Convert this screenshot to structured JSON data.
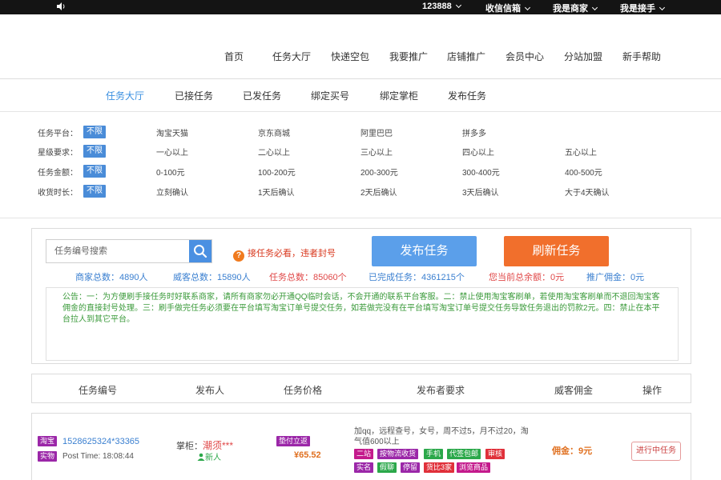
{
  "topbar": {
    "account": "123888",
    "items": [
      "收信信箱",
      "我是商家",
      "我是接手"
    ]
  },
  "main_nav": [
    "首页",
    "任务大厅",
    "快递空包",
    "我要推广",
    "店铺推广",
    "会员中心",
    "分站加盟",
    "新手帮助"
  ],
  "sub_nav": [
    "任务大厅",
    "已接任务",
    "已发任务",
    "绑定买号",
    "绑定掌柜",
    "发布任务"
  ],
  "filters": [
    {
      "label": "任务平台：",
      "badge": "不限",
      "options": [
        "淘宝天猫",
        "京东商城",
        "阿里巴巴",
        "拼多多"
      ]
    },
    {
      "label": "星级要求：",
      "badge": "不限",
      "options": [
        "一心以上",
        "二心以上",
        "三心以上",
        "四心以上",
        "五心以上"
      ]
    },
    {
      "label": "任务金额：",
      "badge": "不限",
      "options": [
        "0-100元",
        "100-200元",
        "200-300元",
        "300-400元",
        "400-500元"
      ]
    },
    {
      "label": "收货时长：",
      "badge": "不限",
      "options": [
        "立刻确认",
        "1天后确认",
        "2天后确认",
        "3天后确认",
        "大于4天确认"
      ]
    }
  ],
  "search": {
    "placeholder": "任务编号搜索",
    "warning": "接任务必看，违者封号",
    "publish_label": "发布任务",
    "refresh_label": "刷新任务"
  },
  "stats": [
    {
      "text": "商家总数：4890人",
      "color": "#3a7fd0"
    },
    {
      "text": "威客总数：15890人",
      "color": "#3a7fd0"
    },
    {
      "text": "任务总数：85060个",
      "color": "#e04848"
    },
    {
      "text": "已完成任务：4361215个",
      "color": "#3a7fd0"
    },
    {
      "text": "您当前总余额：0元",
      "color": "#e04848"
    },
    {
      "text": "推广佣金：0元",
      "color": "#3a7fd0"
    }
  ],
  "notice": "公告：一：为方便刷手接任务时好联系商家，请所有商家勿必开通QQ临时会话，不会开通的联系平台客服。二：禁止使用淘宝客刷单，若使用淘宝客刷单而不退回淘宝客佣金的直接封号处理。三：刷手做完任务必须要在平台填写淘宝订单号提交任务，如若做完没有在平台填写淘宝订单号提交任务导致任务退出的罚款2元。四：禁止在本平台拉人到其它平台。",
  "table": {
    "headers": [
      "任务编号",
      "发布人",
      "任务价格",
      "发布者要求",
      "威客佣金",
      "操作"
    ],
    "rows": [
      {
        "platform_tag": "淘宝",
        "type_tag": "实物",
        "task_id": "1528625324*33365",
        "post_time": "Post Time: 18:08:44",
        "publisher_prefix": "掌柜：",
        "publisher_name": "潮须***",
        "publisher_level": "新人",
        "price_tag": "垫付立返",
        "price": "¥65.52",
        "requirement": "加qq，远程查号，女号，周不过5，月不过20，淘气值600以上",
        "req_tags_1": [
          "二站",
          "按物流收货",
          "手机",
          "代签包邮",
          "审核"
        ],
        "req_tags_2": [
          "实名",
          "假聊",
          "停留",
          "货比3家",
          "浏览商品"
        ],
        "commission": "佣金：9元",
        "action": "进行中任务"
      }
    ]
  }
}
